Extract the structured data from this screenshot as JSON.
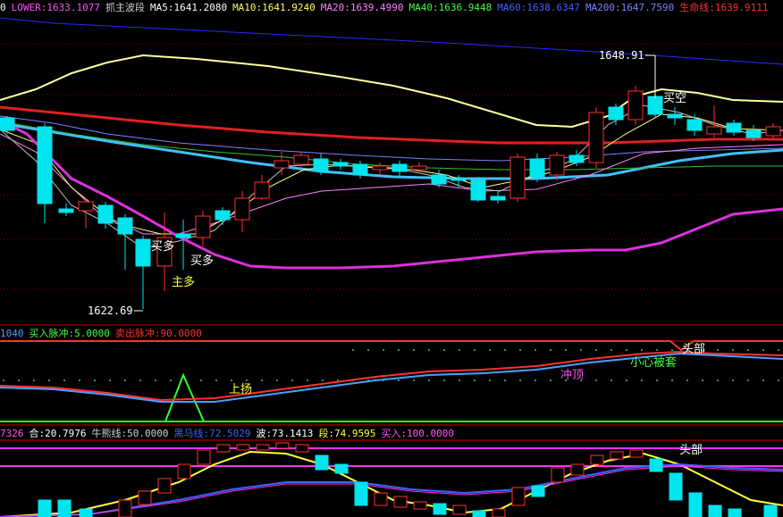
{
  "colors": {
    "background": "#000000",
    "grid": "#8b0000",
    "separator": "#c80000",
    "up": "#ff3030",
    "down": "#00e5ee",
    "label_text": "#ffffff"
  },
  "pane1": {
    "header": [
      {
        "text": "0",
        "color": "#ffffff"
      },
      {
        "text": "LOWER:1633.1077",
        "color": "#ff50ff"
      },
      {
        "text": "抓主波段",
        "color": "#d0d0d0"
      },
      {
        "text": "MA5:1641.2080",
        "color": "#ffffff"
      },
      {
        "text": "MA10:1641.9240",
        "color": "#ffff60"
      },
      {
        "text": "MA20:1639.4990",
        "color": "#ff80ff"
      },
      {
        "text": "MA40:1636.9448",
        "color": "#40ff40"
      },
      {
        "text": "MA60:1638.6347",
        "color": "#4060ff"
      },
      {
        "text": "MA200:1647.7590",
        "color": "#8080ff"
      },
      {
        "text": "生命线:1639.9111",
        "color": "#ff3030"
      }
    ],
    "high_label": "1648.91",
    "low_label": "1622.69",
    "signals": [
      {
        "id": "buy1",
        "text": "买多"
      },
      {
        "id": "buy2",
        "text": "买多"
      },
      {
        "id": "main_buy",
        "text": "主多"
      },
      {
        "id": "short",
        "text": "买空"
      }
    ]
  },
  "pane2": {
    "header": [
      {
        "text": "1040",
        "color": "#4aa0ff"
      },
      {
        "text": "买入脉冲:5.0000",
        "color": "#40ff40"
      },
      {
        "text": "卖出脉冲:90.0000",
        "color": "#ff3030"
      }
    ],
    "labels": [
      {
        "id": "rise",
        "text": "上扬",
        "color": "#ffff40"
      },
      {
        "id": "surge",
        "text": "冲顶",
        "color": "#ff50ff"
      },
      {
        "id": "trap",
        "text": "小心被套",
        "color": "#40ff40"
      },
      {
        "id": "top",
        "text": "头部",
        "color": "#ffffff"
      }
    ]
  },
  "pane3": {
    "header": [
      {
        "text": "7326",
        "color": "#ff50ff"
      },
      {
        "text": "合:20.7976",
        "color": "#ffffff"
      },
      {
        "text": "牛熊线:50.0000",
        "color": "#d0d0d0"
      },
      {
        "text": "黑马线:72.5029",
        "color": "#4060ff"
      },
      {
        "text": "波:73.1413",
        "color": "#ffffff"
      },
      {
        "text": "段:74.9595",
        "color": "#ffff40"
      },
      {
        "text": "买入:100.0000",
        "color": "#ff50ff"
      }
    ],
    "labels": [
      {
        "id": "top",
        "text": "头部",
        "color": "#ffffff"
      }
    ]
  }
}
